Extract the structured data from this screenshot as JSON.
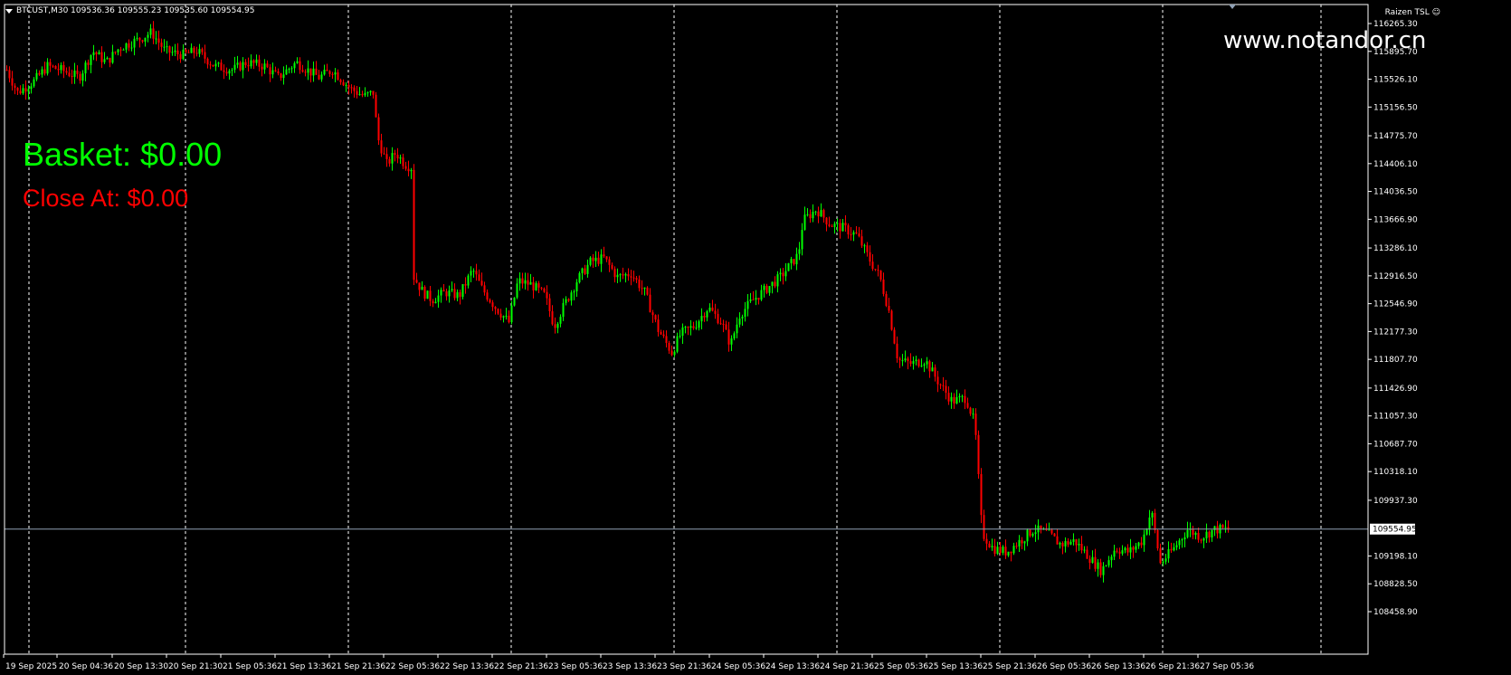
{
  "header": {
    "symbol_line": "BTCUST,M30  109536.36 109555.23 109535.60 109554.95"
  },
  "indicator_label": "Raizen TSL",
  "brand_text": "www.notandor.cn",
  "basket_label": "Basket: $0.00",
  "close_at_label": "Close At: $0.00",
  "colors": {
    "background": "#000000",
    "bull": "#00ff00",
    "bear": "#ff0000",
    "grid": "#ffffff",
    "price_line": "#8fa0b4"
  },
  "chart_data": {
    "type": "candlestick",
    "symbol": "BTCUST",
    "timeframe": "M30",
    "ylim": [
      108458.9,
      116450.0
    ],
    "price_labels": [
      "116265.30",
      "115895.70",
      "115526.10",
      "115156.50",
      "114775.70",
      "114406.10",
      "114036.50",
      "113666.90",
      "113286.10",
      "112916.50",
      "112546.90",
      "112177.30",
      "111807.70",
      "111426.90",
      "111057.30",
      "110687.70",
      "110318.10",
      "109937.30",
      "109198.10",
      "108828.50",
      "108458.90"
    ],
    "price_values": [
      116265.3,
      115895.7,
      115526.1,
      115156.5,
      114775.7,
      114406.1,
      114036.5,
      113666.9,
      113286.1,
      112916.5,
      112546.9,
      112177.3,
      111807.7,
      111426.9,
      111057.3,
      110687.7,
      110318.1,
      109937.3,
      109198.1,
      108828.5,
      108458.9
    ],
    "current_price": 109554.95,
    "current_price_label": "109554.95",
    "time_labels": [
      "19 Sep 2025",
      "20 Sep 04:36",
      "20 Sep 13:30",
      "20 Sep 21:30",
      "21 Sep 05:36",
      "21 Sep 13:36",
      "21 Sep 21:36",
      "22 Sep 05:36",
      "22 Sep 13:36",
      "22 Sep 21:36",
      "23 Sep 05:36",
      "23 Sep 13:36",
      "23 Sep 21:36",
      "24 Sep 05:36",
      "24 Sep 13:36",
      "24 Sep 21:36",
      "25 Sep 05:36",
      "25 Sep 13:36",
      "25 Sep 21:36",
      "26 Sep 05:36",
      "26 Sep 13:36",
      "26 Sep 21:36",
      "27 Sep 05:36"
    ],
    "close_path": [
      [
        0,
        115650
      ],
      [
        12,
        115350
      ],
      [
        30,
        115500
      ],
      [
        45,
        115700
      ],
      [
        60,
        115650
      ],
      [
        80,
        115550
      ],
      [
        95,
        115900
      ],
      [
        110,
        115750
      ],
      [
        125,
        115950
      ],
      [
        145,
        116050
      ],
      [
        160,
        116150
      ],
      [
        175,
        115900
      ],
      [
        195,
        115850
      ],
      [
        210,
        115900
      ],
      [
        230,
        115700
      ],
      [
        250,
        115650
      ],
      [
        265,
        115750
      ],
      [
        285,
        115700
      ],
      [
        300,
        115550
      ],
      [
        320,
        115750
      ],
      [
        345,
        115550
      ],
      [
        360,
        115650
      ],
      [
        380,
        115400
      ],
      [
        395,
        115300
      ],
      [
        405,
        115350
      ],
      [
        410,
        114750
      ],
      [
        420,
        114400
      ],
      [
        430,
        114550
      ],
      [
        440,
        114400
      ],
      [
        448,
        114350
      ],
      [
        450,
        112900
      ],
      [
        460,
        112700
      ],
      [
        470,
        112600
      ],
      [
        485,
        112700
      ],
      [
        500,
        112650
      ],
      [
        515,
        113000
      ],
      [
        525,
        112750
      ],
      [
        540,
        112500
      ],
      [
        555,
        112300
      ],
      [
        565,
        112850
      ],
      [
        580,
        112800
      ],
      [
        595,
        112650
      ],
      [
        605,
        112250
      ],
      [
        615,
        112500
      ],
      [
        630,
        112850
      ],
      [
        645,
        113100
      ],
      [
        660,
        113150
      ],
      [
        675,
        112900
      ],
      [
        690,
        112950
      ],
      [
        705,
        112700
      ],
      [
        720,
        112200
      ],
      [
        735,
        111900
      ],
      [
        745,
        112150
      ],
      [
        760,
        112250
      ],
      [
        775,
        112500
      ],
      [
        790,
        112300
      ],
      [
        800,
        112000
      ],
      [
        810,
        112400
      ],
      [
        825,
        112600
      ],
      [
        840,
        112750
      ],
      [
        855,
        112900
      ],
      [
        875,
        113200
      ],
      [
        880,
        113650
      ],
      [
        895,
        113800
      ],
      [
        910,
        113600
      ],
      [
        925,
        113550
      ],
      [
        940,
        113450
      ],
      [
        955,
        113100
      ],
      [
        965,
        112900
      ],
      [
        975,
        112450
      ],
      [
        985,
        111800
      ],
      [
        1000,
        111750
      ],
      [
        1015,
        111800
      ],
      [
        1030,
        111500
      ],
      [
        1045,
        111250
      ],
      [
        1060,
        111300
      ],
      [
        1070,
        110950
      ],
      [
        1078,
        109500
      ],
      [
        1090,
        109300
      ],
      [
        1105,
        109250
      ],
      [
        1120,
        109400
      ],
      [
        1135,
        109550
      ],
      [
        1150,
        109500
      ],
      [
        1165,
        109350
      ],
      [
        1180,
        109400
      ],
      [
        1195,
        109200
      ],
      [
        1210,
        109000
      ],
      [
        1225,
        109300
      ],
      [
        1240,
        109250
      ],
      [
        1255,
        109400
      ],
      [
        1265,
        109800
      ],
      [
        1275,
        109100
      ],
      [
        1290,
        109300
      ],
      [
        1305,
        109550
      ],
      [
        1320,
        109450
      ],
      [
        1335,
        109550
      ],
      [
        1350,
        109555
      ]
    ]
  }
}
